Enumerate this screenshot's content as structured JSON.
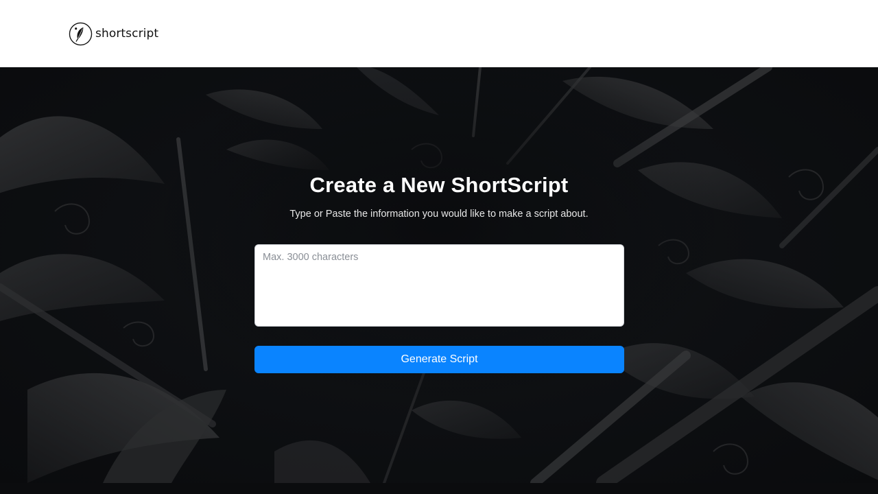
{
  "header": {
    "brand_name": "shortscript",
    "logo_icon": "quill-feather-icon"
  },
  "hero": {
    "background": "dark-feathers-and-quills-illustration",
    "title": "Create a New ShortScript",
    "subtitle": "Type or Paste the information you would like to make a script about.",
    "input": {
      "placeholder": "Max. 3000 characters",
      "value": ""
    },
    "generate_button_label": "Generate Script"
  },
  "colors": {
    "header_bg": "#ffffff",
    "hero_bg": "#0b0c0e",
    "accent": "#0a84ff",
    "title_text": "#ffffff"
  }
}
